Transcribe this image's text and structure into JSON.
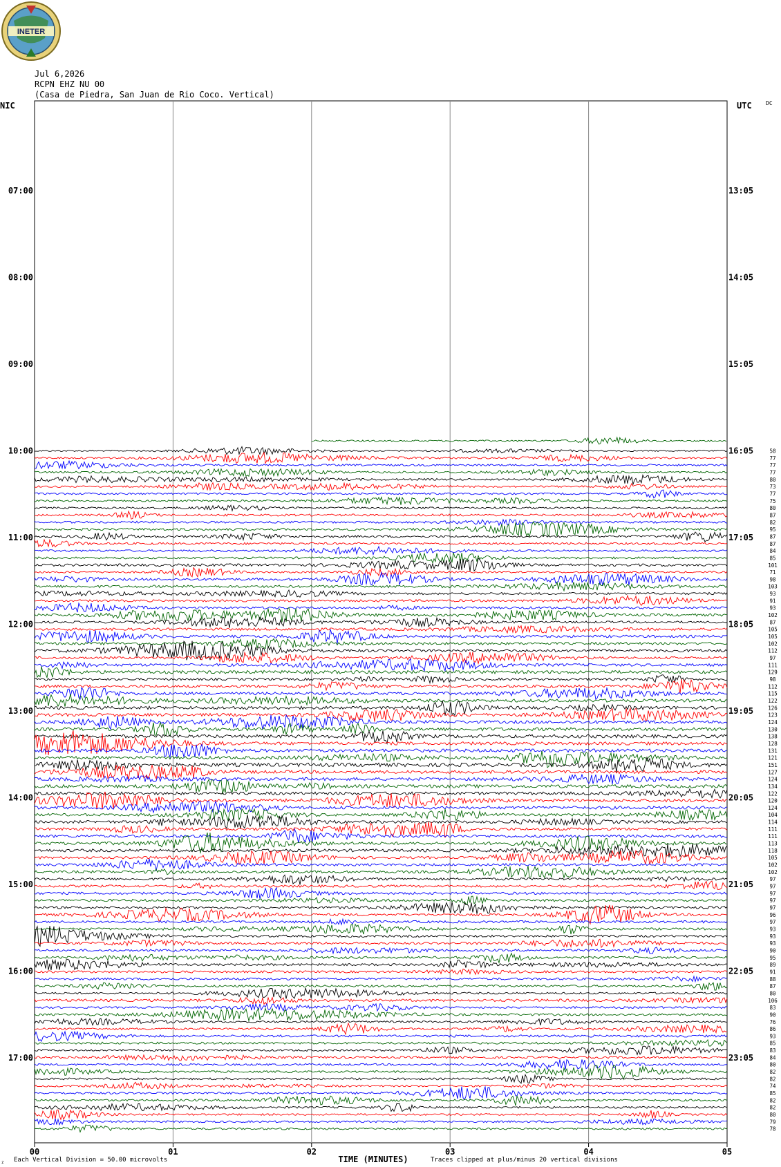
{
  "logo": {
    "text": "INETER"
  },
  "header": {
    "date": "Jul 6,2026",
    "station": "RCPN EHZ NU 00",
    "location": "(Casa de Piedra, San Juan de Rio Coco. Vertical)"
  },
  "corner_labels": {
    "left": "NIC",
    "right": "UTC",
    "dc": "DC"
  },
  "footer": {
    "scale_note": "Each Vertical Division =    50.00 microvolts",
    "clip_note": "Traces clipped at plus/minus 20 vertical divisions",
    "corner_mark": "z"
  },
  "chart_data": {
    "type": "line",
    "title": "",
    "xlabel": "TIME (MINUTES)",
    "x_ticks": [
      "00",
      "01",
      "02",
      "03",
      "04",
      "05"
    ],
    "xlim": [
      0,
      5
    ],
    "left_time_labels": [
      "07:00",
      "08:00",
      "09:00",
      "10:00",
      "11:00",
      "12:00",
      "13:00",
      "14:00",
      "15:00",
      "16:00",
      "17:00"
    ],
    "right_time_labels": [
      "13:05",
      "14:05",
      "15:05",
      "16:05",
      "17:05",
      "18:05",
      "19:05",
      "20:05",
      "21:05",
      "22:05",
      "23:05"
    ],
    "trace_colors": [
      "#000000",
      "#ff0000",
      "#0000ff",
      "#006400"
    ],
    "start_hour": "10:00",
    "trace_count": 96,
    "right_values": [
      58,
      77,
      77,
      77,
      80,
      73,
      77,
      75,
      80,
      87,
      82,
      95,
      87,
      87,
      84,
      85,
      101,
      71,
      98,
      103,
      93,
      91,
      93,
      102,
      87,
      105,
      105,
      102,
      112,
      97,
      111,
      129,
      98,
      112,
      115,
      122,
      126,
      123,
      124,
      130,
      138,
      128,
      131,
      121,
      151,
      127,
      124,
      134,
      122,
      120,
      124,
      104,
      114,
      111,
      111,
      113,
      118,
      105,
      102,
      102,
      97,
      97,
      97,
      97,
      97,
      96,
      97,
      93,
      93,
      93,
      90,
      95,
      89,
      91,
      88,
      87,
      80,
      106,
      83,
      90,
      76,
      86,
      93,
      85,
      83,
      84,
      80,
      82,
      82,
      74,
      85,
      82,
      82,
      80,
      79,
      78
    ]
  }
}
